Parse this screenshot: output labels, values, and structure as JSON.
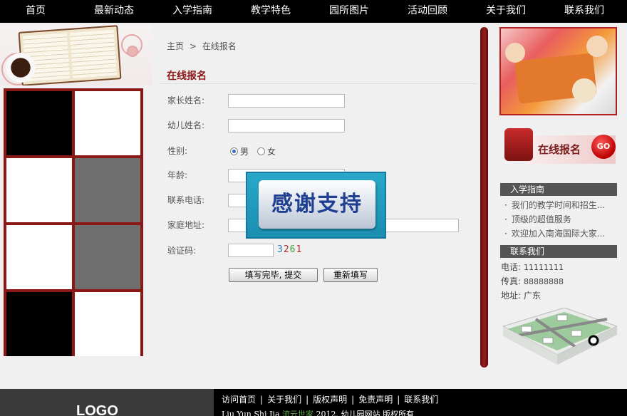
{
  "nav": {
    "items": [
      "首页",
      "最新动态",
      "入学指南",
      "教学特色",
      "园所图片",
      "活动回顾",
      "关于我们",
      "联系我们"
    ]
  },
  "breadcrumb": {
    "home": "主页",
    "separator": ">",
    "current": "在线报名"
  },
  "page_title": "在线报名",
  "form": {
    "parent_name_label": "家长姓名:",
    "child_name_label": "幼儿姓名:",
    "gender_label": "性别:",
    "gender_options": [
      "男",
      "女"
    ],
    "gender_selected": "男",
    "age_label": "年龄:",
    "phone_label": "联系电话:",
    "address_label": "家庭地址:",
    "captcha_label": "验证码:",
    "captcha_digits": [
      "3",
      "2",
      "6",
      "1"
    ],
    "captcha_colors": [
      "#2a7fb8",
      "#b52a2a",
      "#3a9a3a",
      "#b52a2a"
    ],
    "submit_label": "填写完毕, 提交",
    "reset_label": "重新填写"
  },
  "overlay": {
    "text": "感谢支持"
  },
  "sidebar": {
    "register_banner_text": "在线报名",
    "register_go": "GO",
    "guide_title": "入学指南",
    "guide_items": [
      "我们的教学时间和招生...",
      "顶级的超值服务",
      "欢迎加入南海国际大家..."
    ],
    "contact_title": "联系我们",
    "phone_label": "电话:",
    "phone_value": "11111111",
    "fax_label": "传真:",
    "fax_value": "88888888",
    "address_label": "地址:",
    "address_value": "广东"
  },
  "footer": {
    "logo": "LOGO",
    "links": [
      "访问首页",
      "关于我们",
      "版权声明",
      "免责声明",
      "联系我们"
    ],
    "copyright_prefix": "Liu Yun Shi Jia",
    "copyright_brand": "流云世家",
    "copyright_suffix": "2012. 幼儿园网站 版权所有"
  },
  "colors": {
    "accent": "#8b1717",
    "nav_bg": "#000000",
    "overlay_bg": "#1b8eb1"
  }
}
